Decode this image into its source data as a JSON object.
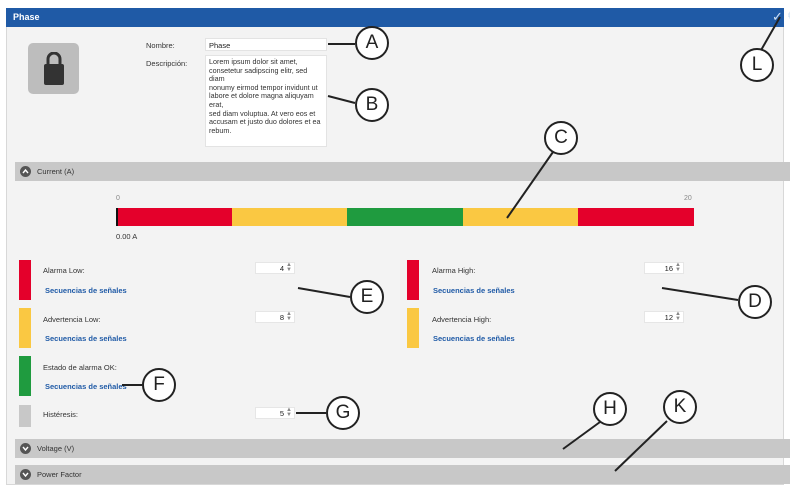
{
  "window": {
    "title": "Phase",
    "confirm_icon": "check-icon",
    "settings_icon": "gear-icon"
  },
  "tile": {
    "icon": "lock-icon"
  },
  "form": {
    "name_label": "Nombre:",
    "name_value": "Phase",
    "description_label": "Descripción:",
    "description_value": "Lorem ipsum dolor sit amet,\nconsetetur sadipscing elitr, sed diam\nnonumy eirmod tempor invidunt ut\nlabore et dolore magna aliquyam erat,\nsed diam voluptua. At vero eos et\naccusam et justo duo dolores et ea\nrebum."
  },
  "sections": {
    "current": {
      "title": "Current (A)",
      "expanded": true
    },
    "voltage": {
      "title": "Voltage (V)",
      "expanded": false
    },
    "power_factor": {
      "title": "Power Factor",
      "expanded": false
    }
  },
  "range_bar": {
    "min_label": "0",
    "max_label": "20",
    "value_label": "0.00 A",
    "current_value": 0,
    "segments": [
      {
        "color": "#e4002b"
      },
      {
        "color": "#fac842"
      },
      {
        "color": "#1f9b3f"
      },
      {
        "color": "#fac842"
      },
      {
        "color": "#e4002b"
      }
    ]
  },
  "thresholds": {
    "alarm_low": {
      "label": "Alarma Low:",
      "value": "4",
      "link": "Secuencias de señales",
      "color": "#e4002b"
    },
    "warning_low": {
      "label": "Advertencia Low:",
      "value": "8",
      "link": "Secuencias de señales",
      "color": "#fac842"
    },
    "alarm_ok": {
      "label": "Estado de alarma OK:",
      "link": "Secuencias de señales",
      "color": "#1f9b3f"
    },
    "hysteresis": {
      "label": "Histéresis:",
      "value": "5",
      "color": "#c8c8c8"
    },
    "alarm_high": {
      "label": "Alarma High:",
      "value": "16",
      "link": "Secuencias de señales",
      "color": "#e4002b"
    },
    "warning_high": {
      "label": "Advertencia High:",
      "value": "12",
      "link": "Secuencias de señales",
      "color": "#fac842"
    }
  },
  "callouts": {
    "A": "A",
    "B": "B",
    "C": "C",
    "D": "D",
    "E": "E",
    "F": "F",
    "G": "G",
    "H": "H",
    "K": "K",
    "L": "L"
  }
}
